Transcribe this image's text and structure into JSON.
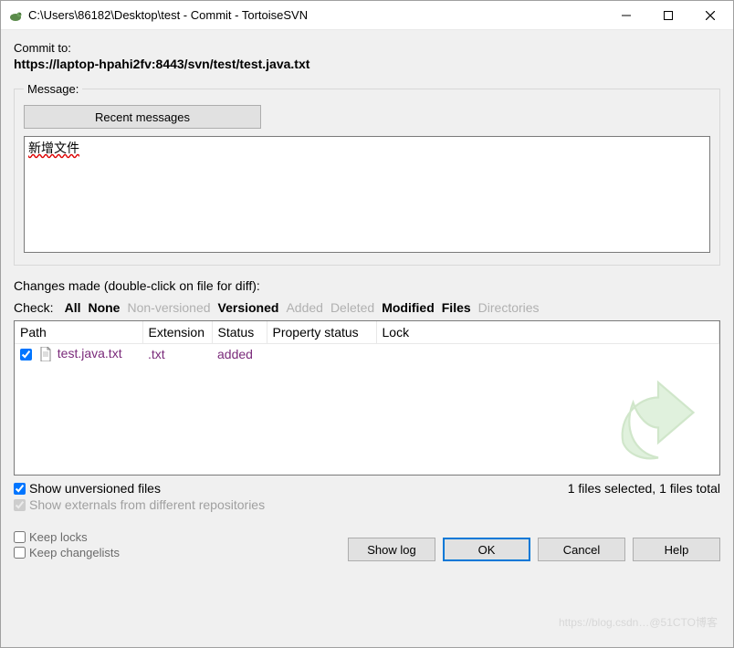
{
  "window": {
    "title": "C:\\Users\\86182\\Desktop\\test - Commit - TortoiseSVN"
  },
  "commit_to_label": "Commit to:",
  "commit_url": "https://laptop-hpahi2fv:8443/svn/test/test.java.txt",
  "message_group_label": "Message:",
  "recent_messages_btn": "Recent messages",
  "message_text": "新增文件",
  "changes_label": "Changes made (double-click on file for diff):",
  "filters": {
    "check_label": "Check:",
    "all": "All",
    "none": "None",
    "nonversioned": "Non-versioned",
    "versioned": "Versioned",
    "added": "Added",
    "deleted": "Deleted",
    "modified": "Modified",
    "files": "Files",
    "directories": "Directories"
  },
  "table": {
    "headers": {
      "path": "Path",
      "extension": "Extension",
      "status": "Status",
      "property_status": "Property status",
      "lock": "Lock"
    },
    "rows": [
      {
        "checked": true,
        "path": "test.java.txt",
        "extension": ".txt",
        "status": "added",
        "property_status": "",
        "lock": ""
      }
    ]
  },
  "show_unversioned": "Show unversioned files",
  "show_externals": "Show externals from different repositories",
  "status_text": "1 files selected, 1 files total",
  "keep_locks": "Keep locks",
  "keep_changelists": "Keep changelists",
  "buttons": {
    "show_log": "Show log",
    "ok": "OK",
    "cancel": "Cancel",
    "help": "Help"
  },
  "watermark": "https://blog.csdn…@51CTO博客"
}
